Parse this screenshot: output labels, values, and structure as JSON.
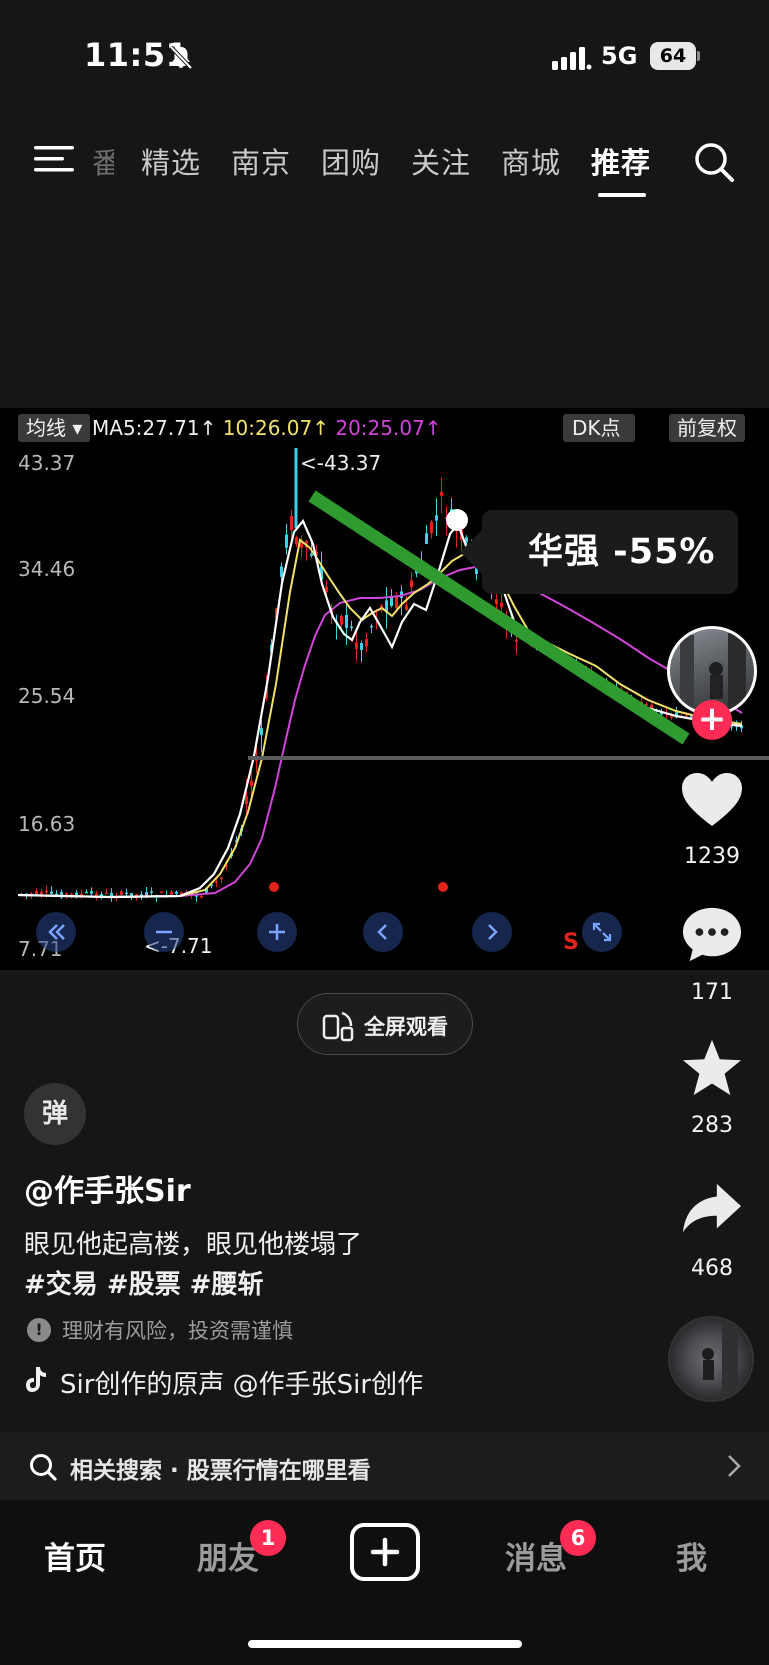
{
  "status_bar": {
    "time": "11:51",
    "network": "5G",
    "battery": "64"
  },
  "top_nav": {
    "partial_tab": "番",
    "tabs": [
      {
        "label": "精选",
        "active": false
      },
      {
        "label": "南京",
        "active": false
      },
      {
        "label": "团购",
        "active": false
      },
      {
        "label": "关注",
        "active": false
      },
      {
        "label": "商城",
        "active": false
      },
      {
        "label": "推荐",
        "active": true
      }
    ],
    "icons": [
      "menu-icon",
      "search-icon"
    ]
  },
  "video": {
    "chart_header": {
      "legend_button": "均线",
      "ma5": "MA5:27.71↑",
      "ma10": "10:26.07↑",
      "ma20": "20:25.07↑",
      "dk_button": "DK点",
      "adjust_button": "前复权"
    },
    "y_labels": [
      "43.37",
      "34.46",
      "25.54",
      "16.63",
      "7.71"
    ],
    "high_label": "<-43.37",
    "low_label": "<-7.71",
    "callout": "华强 -55%",
    "colors": {
      "ma5": "#eeeeee",
      "ma10": "#f2e26a",
      "ma20": "#d145d8",
      "trendline": "#2f9a2f",
      "up": "#e2231a",
      "down": "#3fd0e6"
    },
    "controls": [
      "rewind-icon",
      "zoom-out-icon",
      "zoom-in-icon",
      "prev-icon",
      "next-icon",
      "expand-icon"
    ],
    "control_marker": "S"
  },
  "chart_data": {
    "type": "line",
    "y_ticks": [
      43.37,
      34.46,
      25.54,
      16.63,
      7.71
    ],
    "ylim": [
      7.71,
      43.37
    ],
    "high": 43.37,
    "low": 7.71,
    "series": [
      {
        "name": "MA5",
        "last": 27.71
      },
      {
        "name": "10",
        "last": 26.07
      },
      {
        "name": "20",
        "last": 25.07
      }
    ],
    "annotation": "华强 -55%"
  },
  "right_rail": {
    "like_count": "1239",
    "comment_count": "171",
    "favorite_count": "283",
    "share_count": "468",
    "follow_label": "+"
  },
  "meta": {
    "fullscreen_label": "全屏观看",
    "danmu_label": "弹",
    "author": "@作手张Sir",
    "description": "眼见他起高楼，眼见他楼塌了",
    "hashtags": "#交易 #股票 #腰斩",
    "risk_notice": "理财有风险，投资需谨慎",
    "risk_icon_label": "!",
    "music": "Sir创作的原声    @作手张Sir创作",
    "related_search": "相关搜索 · 股票行情在哪里看"
  },
  "bottom_nav": {
    "home": "首页",
    "friends": "朋友",
    "friends_badge": "1",
    "messages": "消息",
    "messages_badge": "6",
    "me": "我"
  }
}
